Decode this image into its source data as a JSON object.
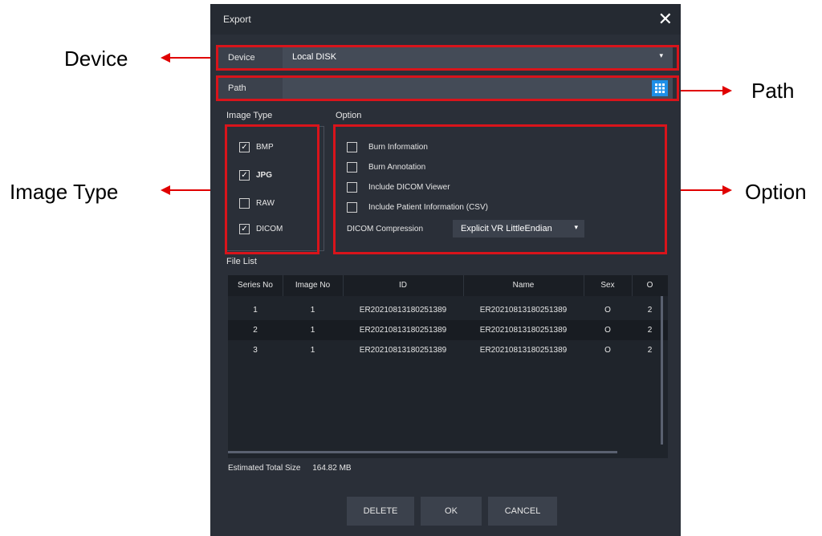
{
  "callouts": {
    "device": "Device",
    "path": "Path",
    "image_type": "Image Type",
    "option": "Option"
  },
  "dialog": {
    "title": "Export",
    "close_glyph": "✕",
    "device": {
      "label": "Device",
      "value": "Local DISK",
      "arrow": "▾"
    },
    "path": {
      "label": "Path",
      "value": ""
    },
    "image_type": {
      "label": "Image Type",
      "items": [
        {
          "label": "BMP",
          "checked": true
        },
        {
          "label": "JPG",
          "checked": true
        },
        {
          "label": "RAW",
          "checked": false
        },
        {
          "label": "DICOM",
          "checked": true
        }
      ]
    },
    "option": {
      "label": "Option",
      "items": [
        {
          "label": "Burn Information",
          "checked": false
        },
        {
          "label": "Burn Annotation",
          "checked": false
        },
        {
          "label": "Include DICOM Viewer",
          "checked": false
        },
        {
          "label": "Include Patient Information (CSV)",
          "checked": false
        }
      ],
      "compression_label": "DICOM Compression",
      "compression_value": "Explicit VR LittleEndian",
      "compression_arrow": "▾"
    },
    "file_list": {
      "label": "File List",
      "columns": [
        "Series No",
        "Image No",
        "ID",
        "Name",
        "Sex",
        "O"
      ],
      "rows": [
        [
          "1",
          "1",
          "ER20210813180251389",
          "ER20210813180251389",
          "O",
          "2"
        ],
        [
          "2",
          "1",
          "ER20210813180251389",
          "ER20210813180251389",
          "O",
          "2"
        ],
        [
          "3",
          "1",
          "ER20210813180251389",
          "ER20210813180251389",
          "O",
          "2"
        ]
      ]
    },
    "estimated": {
      "label": "Estimated Total Size",
      "value": "164.82 MB"
    },
    "buttons": {
      "delete": "DELETE",
      "ok": "OK",
      "cancel": "CANCEL"
    }
  },
  "colors": {
    "dialog_bg": "#2a2f38",
    "highlight_red": "#d9141b",
    "accent_blue": "#1e8fe8"
  }
}
